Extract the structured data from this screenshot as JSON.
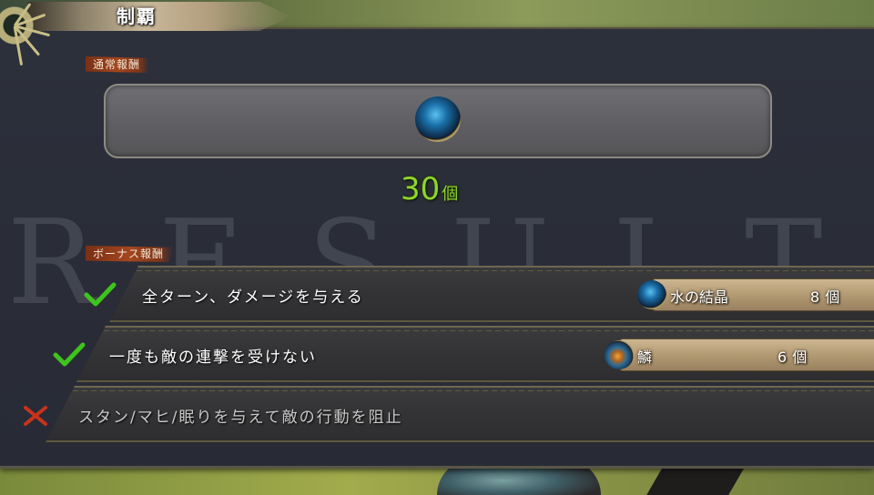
{
  "header": {
    "title": "制覇"
  },
  "watermark": "RESULT",
  "normal_reward": {
    "label": "通常報酬",
    "item_icon": "water-crystal-icon",
    "quantity": "30",
    "unit": "個"
  },
  "bonus_reward": {
    "label": "ボーナス報酬",
    "conditions": [
      {
        "text": "全ターン、ダメージを与える",
        "achieved": true,
        "status_icon": "check-icon",
        "item_icon": "water-crystal-icon",
        "item_name": "水の結晶",
        "count": "8",
        "unit": "個"
      },
      {
        "text": "一度も敵の連撃を受けない",
        "achieved": true,
        "status_icon": "check-icon",
        "item_icon": "scale-icon",
        "item_name": "鱗",
        "count": "6",
        "unit": "個"
      },
      {
        "text": "スタン/マヒ/眠りを与えて敵の行動を阻止",
        "achieved": false,
        "status_icon": "cross-icon"
      }
    ]
  },
  "colors": {
    "check": "#3ec41c",
    "cross": "#c8331c",
    "quantity": "#8fd62a",
    "label_tag": "#a3461f"
  }
}
